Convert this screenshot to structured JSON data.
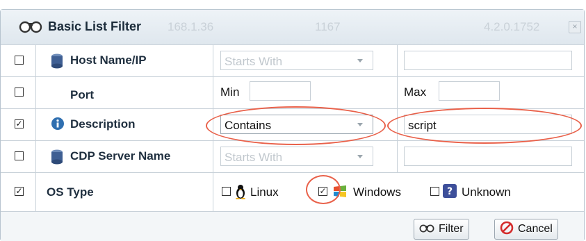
{
  "dialog": {
    "title": "Basic List Filter",
    "ghost_ip": "168.1.36",
    "ghost_count": "1167",
    "ghost_version": "4.2.0.1752",
    "close_label": "×"
  },
  "rows": [
    {
      "checked": false,
      "icon": "database-icon",
      "label": "Host Name/IP",
      "operator": "Starts With",
      "value": ""
    },
    {
      "checked": false,
      "icon": "",
      "label": "Port",
      "min_label": "Min",
      "min_value": "",
      "max_label": "Max",
      "max_value": ""
    },
    {
      "checked": true,
      "icon": "info-icon",
      "label": "Description",
      "operator": "Contains",
      "value": "script"
    },
    {
      "checked": false,
      "icon": "database-icon",
      "label": "CDP Server Name",
      "operator": "Starts With",
      "value": ""
    },
    {
      "checked": true,
      "icon": "",
      "label": "OS Type",
      "options": [
        {
          "label": "Linux",
          "checked": false,
          "icon": "linux-penguin-icon"
        },
        {
          "label": "Windows",
          "checked": true,
          "icon": "windows-flag-icon"
        },
        {
          "label": "Unknown",
          "checked": false,
          "icon": "question-icon"
        }
      ]
    }
  ],
  "check_mark": "✓",
  "buttons": {
    "filter": "Filter",
    "cancel": "Cancel"
  },
  "colors": {
    "highlight": "#e9614a",
    "accent": "#2f6fb0",
    "cancel_icon": "#d42c2c"
  }
}
